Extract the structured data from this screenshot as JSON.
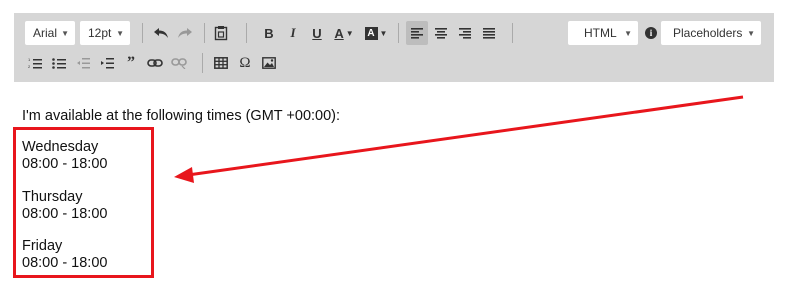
{
  "toolbar": {
    "font_family": "Arial",
    "font_size": "12pt",
    "format_select": "HTML",
    "placeholders_select": "Placeholders",
    "icons_row1": [
      "undo-icon",
      "redo-icon",
      "paste-icon",
      "bold-icon",
      "italic-icon",
      "underline-icon",
      "text-color-icon",
      "background-color-icon",
      "align-left-icon",
      "align-center-icon",
      "align-right-icon",
      "align-justify-icon",
      "info-icon"
    ],
    "icons_row2": [
      "numbered-list-icon",
      "bulleted-list-icon",
      "outdent-icon",
      "indent-icon",
      "blockquote-icon",
      "link-icon",
      "unlink-icon",
      "table-icon",
      "special-char-icon",
      "image-icon"
    ]
  },
  "content": {
    "intro": "I'm available at the following times (GMT +00:00):",
    "slots": [
      {
        "day": "Wednesday",
        "time": "08:00 - 18:00"
      },
      {
        "day": "Thursday",
        "time": "08:00 - 18:00"
      },
      {
        "day": "Friday",
        "time": "08:00 - 18:00"
      }
    ]
  },
  "colors": {
    "toolbar_bg": "#d6d6d6",
    "annotation_red": "#e8161c"
  }
}
